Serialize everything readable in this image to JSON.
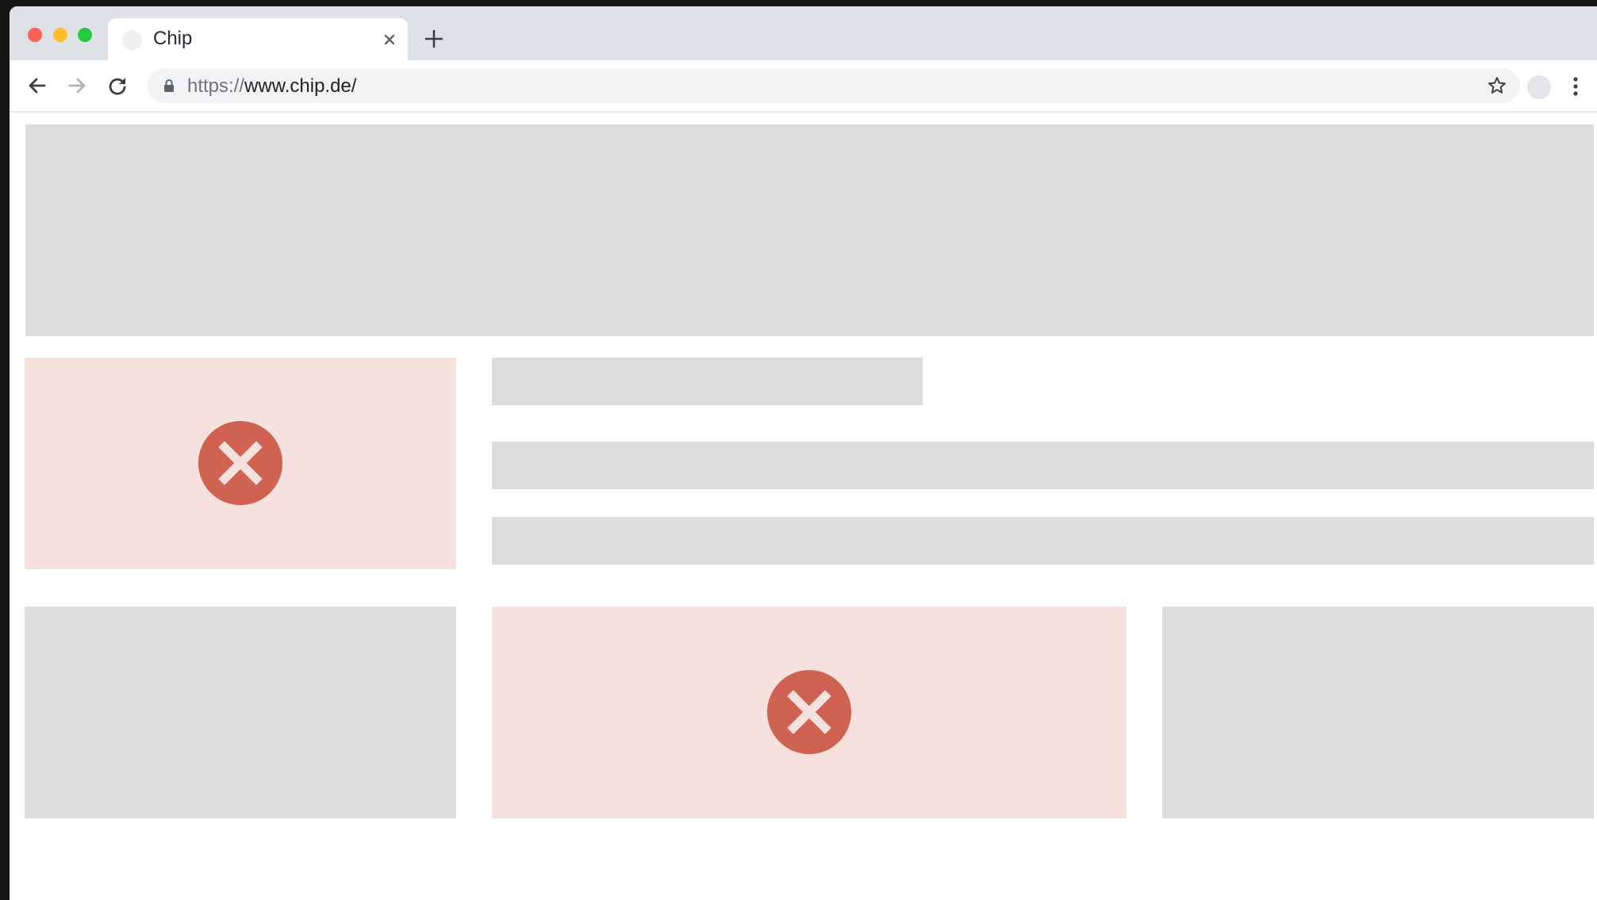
{
  "browser": {
    "tab": {
      "title": "Chip"
    },
    "address_bar": {
      "scheme": "https://",
      "host": "www.chip.de/"
    },
    "controls": {
      "traffic_lights": [
        "close",
        "minimize",
        "zoom"
      ],
      "traffic_colors": [
        "#ff5f57",
        "#ffbd2e",
        "#28c940"
      ],
      "icons": [
        "back-arrow-icon",
        "forward-arrow-icon",
        "reload-icon",
        "lock-icon",
        "star-icon",
        "profile-avatar",
        "more-vert-icon",
        "close-icon",
        "plus-icon"
      ]
    }
  },
  "page": {
    "state": "loading-placeholders",
    "colors": {
      "placeholder": "#dcdcdc",
      "broken_image_bg": "#f7e1de",
      "error_badge": "#cf6251"
    },
    "blocks": [
      {
        "name": "header-banner-placeholder",
        "kind": "placeholder"
      },
      {
        "name": "broken-image-1",
        "kind": "broken-image"
      },
      {
        "name": "headline-placeholder",
        "kind": "placeholder"
      },
      {
        "name": "text-line-placeholder-1",
        "kind": "placeholder"
      },
      {
        "name": "text-line-placeholder-2",
        "kind": "placeholder"
      },
      {
        "name": "card-placeholder-left",
        "kind": "placeholder"
      },
      {
        "name": "broken-image-2",
        "kind": "broken-image"
      },
      {
        "name": "card-placeholder-right",
        "kind": "placeholder"
      }
    ]
  }
}
